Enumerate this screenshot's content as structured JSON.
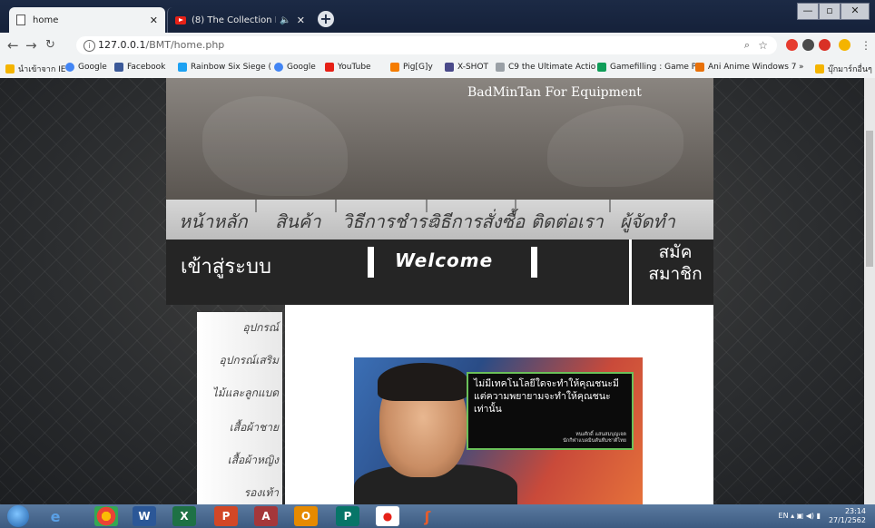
{
  "browser": {
    "tabs": [
      {
        "title": "home",
        "active": true
      },
      {
        "title": "(8) The Collection Beautiful |",
        "active": false
      }
    ],
    "url_host": "127.0.0.1",
    "url_path": "/BMT/home.php",
    "bookmarks": [
      "นำเข้าจาก IE",
      "Google",
      "Facebook",
      "Rainbow Six Siege (",
      "Google",
      "YouTube",
      "Pig[G]y",
      "X-SHOT",
      "C9 the Ultimate Actio",
      "Gamefilling : Game P",
      "Ani Anime Windows 7",
      "»",
      "บุ๊กมาร์กอื่นๆ"
    ]
  },
  "site": {
    "brand": "BadMinTan For Equipment",
    "menu": [
      "หน้าหลัก",
      "สินค้า",
      "วิธีการชำระ",
      "วิธีการสั่งซื้อ",
      "ติดต่อเรา",
      "ผู้จัดทำ"
    ],
    "login": "เข้าสู่ระบบ",
    "welcome": "Welcome",
    "register": "สมัคสมาชิก",
    "sidebar": [
      "อุปกรณ์",
      "อุปกรณ์เสริม",
      "ไม้และลูกแบด",
      "เสื้อผ้าชาย",
      "เสื้อผ้าหญิง",
      "รองเท้า"
    ],
    "quote": "ไม่มีเทคโนโลยีใดจะทำให้คุณชนะมีแต่ความพยายามจะทำให้คุณชนะเท่านั้น",
    "quote_signature_name": "หนเศักดิ์ แสนสมบุญเจต",
    "quote_signature_title": "นักกีฬาแบดมินตันทีมชาติไทย"
  },
  "taskbar": {
    "lang": "EN",
    "time": "23:14",
    "date": "27/1/2562"
  },
  "colors": {
    "menubar": "#c8c8c8",
    "loginbar": "#252525",
    "quote_border": "#6bc05a"
  }
}
